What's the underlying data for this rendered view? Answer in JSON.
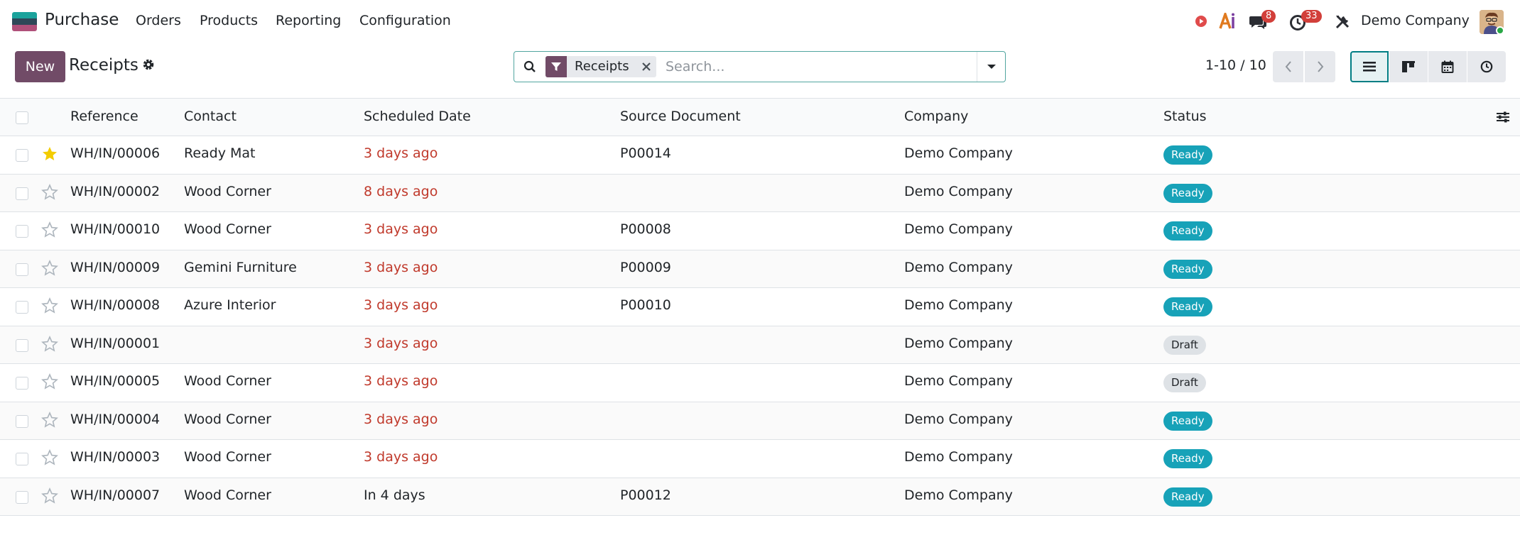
{
  "navbar": {
    "app_name": "Purchase",
    "menu": [
      "Orders",
      "Products",
      "Reporting",
      "Configuration"
    ],
    "messages_count": "8",
    "activities_count": "33",
    "company": "Demo Company"
  },
  "control_panel": {
    "new_label": "New",
    "breadcrumb": "Receipts",
    "search": {
      "facet_label": "Receipts",
      "placeholder": "Search..."
    },
    "pager": "1-10 / 10"
  },
  "list": {
    "columns": {
      "reference": "Reference",
      "contact": "Contact",
      "scheduled_date": "Scheduled Date",
      "source_document": "Source Document",
      "company": "Company",
      "status": "Status"
    },
    "rows": [
      {
        "starred": true,
        "reference": "WH/IN/00006",
        "contact": "Ready Mat",
        "date": "3 days ago",
        "late": true,
        "source": "P00014",
        "company": "Demo Company",
        "status": "Ready",
        "status_kind": "ready"
      },
      {
        "starred": false,
        "reference": "WH/IN/00002",
        "contact": "Wood Corner",
        "date": "8 days ago",
        "late": true,
        "source": "",
        "company": "Demo Company",
        "status": "Ready",
        "status_kind": "ready"
      },
      {
        "starred": false,
        "reference": "WH/IN/00010",
        "contact": "Wood Corner",
        "date": "3 days ago",
        "late": true,
        "source": "P00008",
        "company": "Demo Company",
        "status": "Ready",
        "status_kind": "ready"
      },
      {
        "starred": false,
        "reference": "WH/IN/00009",
        "contact": "Gemini Furniture",
        "date": "3 days ago",
        "late": true,
        "source": "P00009",
        "company": "Demo Company",
        "status": "Ready",
        "status_kind": "ready"
      },
      {
        "starred": false,
        "reference": "WH/IN/00008",
        "contact": "Azure Interior",
        "date": "3 days ago",
        "late": true,
        "source": "P00010",
        "company": "Demo Company",
        "status": "Ready",
        "status_kind": "ready"
      },
      {
        "starred": false,
        "reference": "WH/IN/00001",
        "contact": "",
        "date": "3 days ago",
        "late": true,
        "source": "",
        "company": "Demo Company",
        "status": "Draft",
        "status_kind": "draft"
      },
      {
        "starred": false,
        "reference": "WH/IN/00005",
        "contact": "Wood Corner",
        "date": "3 days ago",
        "late": true,
        "source": "",
        "company": "Demo Company",
        "status": "Draft",
        "status_kind": "draft"
      },
      {
        "starred": false,
        "reference": "WH/IN/00004",
        "contact": "Wood Corner",
        "date": "3 days ago",
        "late": true,
        "source": "",
        "company": "Demo Company",
        "status": "Ready",
        "status_kind": "ready"
      },
      {
        "starred": false,
        "reference": "WH/IN/00003",
        "contact": "Wood Corner",
        "date": "3 days ago",
        "late": true,
        "source": "",
        "company": "Demo Company",
        "status": "Ready",
        "status_kind": "ready"
      },
      {
        "starred": false,
        "reference": "WH/IN/00007",
        "contact": "Wood Corner",
        "date": "In 4 days",
        "late": false,
        "source": "P00012",
        "company": "Demo Company",
        "status": "Ready",
        "status_kind": "ready"
      }
    ]
  },
  "colors": {
    "brand": "#714b67",
    "accent": "#017e84",
    "ready": "#17a2b8",
    "late_date": "#c0392b",
    "star": "#f3cc00"
  }
}
